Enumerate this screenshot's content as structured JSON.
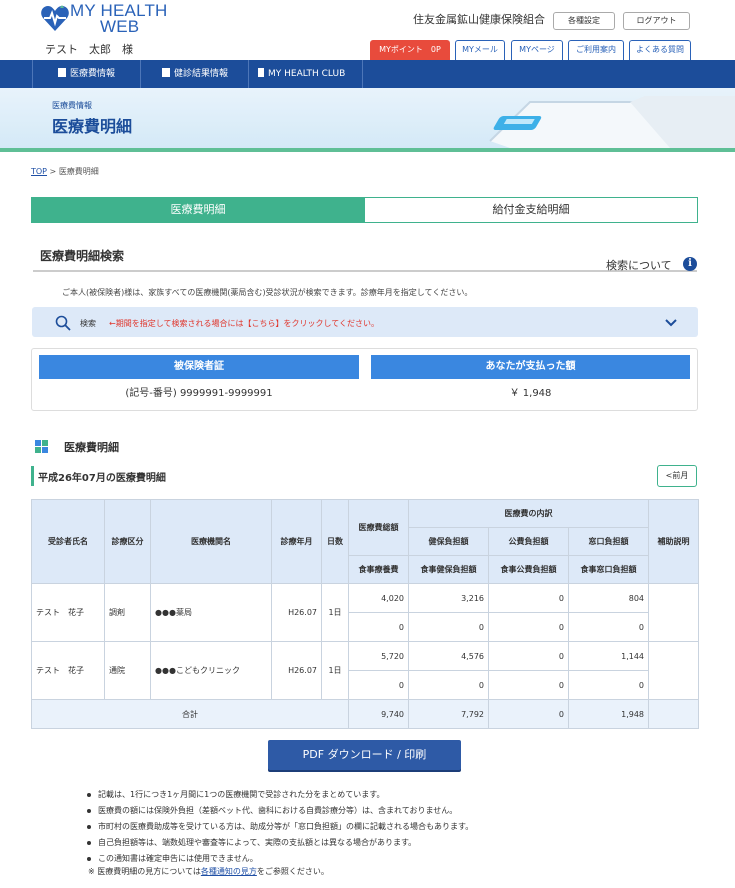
{
  "header": {
    "logo_line1": "MY HEALTH",
    "logo_line2": "WEB",
    "user_name": "テスト　太郎　様",
    "org_name": "住友金属鉱山健康保険組合",
    "settings_label": "各種設定",
    "logout_label": "ログアウト",
    "tabs": [
      "MYポイント　0P",
      "MYメール",
      "MYページ",
      "ご利用案内",
      "よくある質問"
    ]
  },
  "nav": {
    "items": [
      "医療費情報",
      "健診結果情報",
      "MY HEALTH CLUB"
    ]
  },
  "banner": {
    "subtitle": "医療費情報",
    "title": "医療費明細"
  },
  "breadcrumb": {
    "top": "TOP",
    "sep": " > ",
    "current": "医療費明細"
  },
  "tabs": {
    "active": "医療費明細",
    "inactive": "給付金支給明細"
  },
  "search": {
    "title": "医療費明細検索",
    "about": "検索について",
    "description": "ご本人(被保険者)様は、家族すべての医療機関(薬局含む)受診状況が検索できます。診療年月を指定してください。",
    "label": "検索",
    "note": "←期間を指定して検索される場合には【こちら】をクリックしてください。"
  },
  "summary": {
    "insured_head": "被保険者証",
    "insured_value": "(記号-番号) 9999991-9999991",
    "paid_head": "あなたが支払った額",
    "paid_value": "￥ 1,948"
  },
  "detail": {
    "section_title": "医療費明細",
    "month_title": "平成26年07月の医療費明細",
    "prev_button": "<前月",
    "headers": {
      "patient": "受診者氏名",
      "category": "診療区分",
      "institution": "医療機関名",
      "date": "診療年月",
      "days": "日数",
      "total": "医療費総額",
      "breakdown": "医療費の内訳",
      "supplement": "補助説明",
      "food_total": "食事療養費",
      "insurance": "健保負担額",
      "public": "公費負担額",
      "window": "窓口負担額",
      "food_insurance": "食事健保負担額",
      "food_public": "食事公費負担額",
      "food_window": "食事窓口負担額"
    },
    "rows": [
      {
        "patient": "テスト　花子",
        "category": "調剤",
        "institution": "●●●薬局",
        "date": "H26.07",
        "days": "1日",
        "total": "4,020",
        "insurance": "3,216",
        "public": "0",
        "window": "804",
        "food_total": "0",
        "food_insurance": "0",
        "food_public": "0",
        "food_window": "0"
      },
      {
        "patient": "テスト　花子",
        "category": "通院",
        "institution": "●●●こどもクリニック",
        "date": "H26.07",
        "days": "1日",
        "total": "5,720",
        "insurance": "4,576",
        "public": "0",
        "window": "1,144",
        "food_total": "0",
        "food_insurance": "0",
        "food_public": "0",
        "food_window": "0"
      }
    ],
    "sum": {
      "label": "合計",
      "total": "9,740",
      "insurance": "7,792",
      "public": "0",
      "window": "1,948"
    }
  },
  "pdf_button": "PDF ダウンロード / 印刷",
  "notes": [
    "記載は、1行につき1ヶ月間に1つの医療機関で受診された分をまとめています。",
    "医療費の額には保険外負担（差額ベット代、歯科における自費診療分等）は、含まれておりません。",
    "市町村の医療費助成等を受けている方は、助成分等が「窓口負担額」の欄に記載される場合もあります。",
    "自己負担額等は、端数処理や審査等によって、実際の支払額とは異なる場合があります。",
    "この通知書は確定申告には使用できません。"
  ],
  "footnote": {
    "prefix": "※ 医療費明細の見方については",
    "link": "各種通知の見方",
    "suffix": "をご参照ください。"
  },
  "colors": {
    "brand_blue": "#1c4d9a",
    "accent_green": "#3fb28d",
    "header_blue": "#3a87e0",
    "alert_red": "#e0352b"
  }
}
